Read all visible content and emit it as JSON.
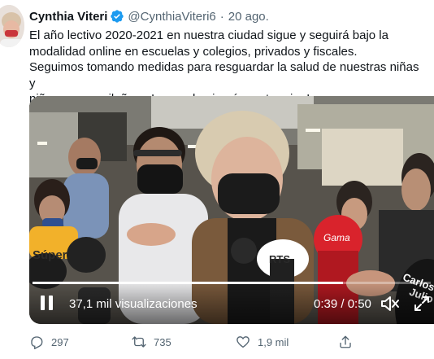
{
  "tweet": {
    "author_name": "Cynthia Viteri",
    "handle": "@CynthiaViteri6",
    "separator": "·",
    "date": "20 ago.",
    "text_lines": [
      "El año lectivo 2020-2021 en nuestra ciudad sigue y seguirá bajo la",
      "modalidad online en escuelas y colegios, privados y fiscales.",
      "Seguimos tomando medidas para resguardar la salud de nuestras niñas y",
      "niños guayaquileños. ¡La pandemia aún no termina!"
    ]
  },
  "media": {
    "views": "37,1 mil visualizaciones",
    "time": "0:39 / 0:50",
    "progress_fraction": 0.78,
    "scene_text": {
      "mic_brand": "Súper",
      "mic_logo_left": "RTS",
      "mic_logo_right": "Gama",
      "mic_label_far_right": "Carlos Julio"
    }
  },
  "actions": {
    "replies": "297",
    "retweets": "735",
    "likes": "1,9 mil"
  },
  "colors": {
    "verified": "#1d9bf0",
    "muted_text": "#536471",
    "text": "#0f1419"
  },
  "icons": [
    "verified-badge-icon",
    "pause-icon",
    "mute-icon",
    "fullscreen-icon",
    "reply-icon",
    "retweet-icon",
    "like-icon",
    "share-icon"
  ]
}
